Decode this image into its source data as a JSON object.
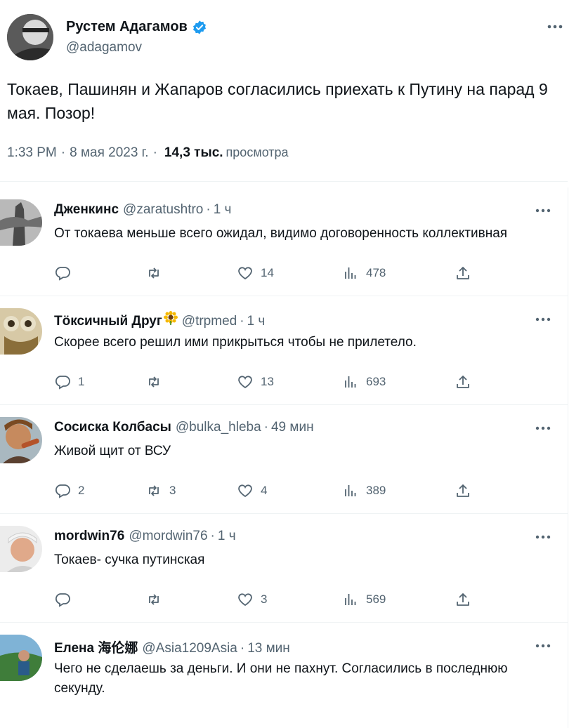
{
  "tweet": {
    "author_name": "Рустем Адагамов",
    "author_handle": "@adagamov",
    "text": "Токаев, Пашинян и Жапаров согласились приехать к Путину на парад 9 мая. Позор!",
    "time": "1:33 PM",
    "date": "8 мая 2023 г.",
    "views_count": "14,3 тыс.",
    "views_label": "просмотра",
    "separator": "·"
  },
  "replies": [
    {
      "name": "Дженкинс",
      "handle": "@zaratushtro",
      "time": "1 ч",
      "text": "От токаева меньше всего ожидал, видимо договоренность коллективная",
      "replies_count": "",
      "retweets_count": "",
      "likes_count": "14",
      "views_count": "478"
    },
    {
      "name": "Тӧксичный Друг",
      "handle": "@trpmed",
      "time": "1 ч",
      "text": "Скорее всего решил ими прикрыться чтобы не прилетело.",
      "replies_count": "1",
      "retweets_count": "",
      "likes_count": "13",
      "views_count": "693"
    },
    {
      "name": "Сосиска Колбасы",
      "handle": "@bulka_hleba",
      "time": "49 мин",
      "text": "Живой щит от ВСУ",
      "replies_count": "2",
      "retweets_count": "3",
      "likes_count": "4",
      "views_count": "389"
    },
    {
      "name": "mordwin76",
      "handle": "@mordwin76",
      "time": "1 ч",
      "text": "Токаев- сучка путинская",
      "replies_count": "",
      "retweets_count": "",
      "likes_count": "3",
      "views_count": "569"
    },
    {
      "name": "Елена 海伦娜",
      "handle": "@Asia1209Asia",
      "time": "13 мин",
      "text": "Чего не сделаешь за деньги. И они не пахнут. Согласились в последнюю секунду.",
      "replies_count": "",
      "retweets_count": "",
      "likes_count": "",
      "views_count": ""
    }
  ],
  "colors": {
    "accent": "#1d9bf0",
    "secondary_text": "#536471",
    "primary_text": "#0f1419",
    "divider": "#eff3f4"
  },
  "icons": [
    "verified-badge-icon",
    "more-options-icon",
    "reply-icon",
    "retweet-icon",
    "like-icon",
    "views-icon",
    "share-icon",
    "sunflower-emoji"
  ]
}
